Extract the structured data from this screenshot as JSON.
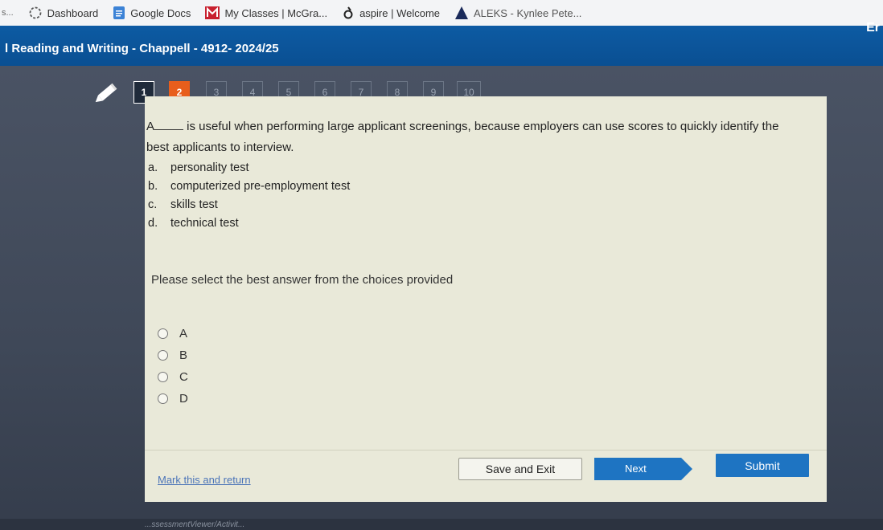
{
  "bookmarks": [
    {
      "label": "s...",
      "icon": "truncated-bookmark"
    },
    {
      "label": "Dashboard",
      "icon": "dashboard-icon"
    },
    {
      "label": "Google Docs",
      "icon": "google-docs-icon"
    },
    {
      "label": "My Classes | McGra...",
      "icon": "mcgraw-hill-icon"
    },
    {
      "label": "aspire | Welcome",
      "icon": "aspire-icon"
    },
    {
      "label": "ALEKS - Kynlee Pete...",
      "icon": "aleks-icon"
    }
  ],
  "header": {
    "course_title": "l Reading and Writing - Chappell - 4912- 2024/25",
    "right_label": "Er"
  },
  "nav": {
    "question_numbers": [
      {
        "label": "1",
        "state": "current"
      },
      {
        "label": "2",
        "state": "answered"
      },
      {
        "label": "3",
        "state": "unanswered"
      },
      {
        "label": "4",
        "state": "unanswered"
      },
      {
        "label": "5",
        "state": "unanswered"
      },
      {
        "label": "6",
        "state": "unanswered"
      },
      {
        "label": "7",
        "state": "unanswered"
      },
      {
        "label": "8",
        "state": "unanswered"
      },
      {
        "label": "9",
        "state": "unanswered"
      },
      {
        "label": "10",
        "state": "unanswered"
      }
    ]
  },
  "question": {
    "prefix": "A",
    "text_after_blank": " is useful when performing large applicant screenings, because employers can use scores to quickly identify the",
    "text_line2": "best applicants to interview.",
    "choices": [
      {
        "letter": "a.",
        "text": "personality test"
      },
      {
        "letter": "b.",
        "text": "computerized pre-employment test"
      },
      {
        "letter": "c.",
        "text": "skills test"
      },
      {
        "letter": "d.",
        "text": "technical test"
      }
    ]
  },
  "prompt": "Please select the best answer from the choices provided",
  "radio_options": [
    "A",
    "B",
    "C",
    "D"
  ],
  "footer": {
    "mark_link": "Mark this and return",
    "save_button": "Save and Exit",
    "next_button": "Next",
    "submit_button": "Submit"
  },
  "status_text": "...ssessmentViewer/Activit...",
  "colors": {
    "header_blue": "#0a4f92",
    "answered_orange": "#e85e1c",
    "submit_blue": "#1e74c2",
    "panel_bg": "#e9e9d9"
  }
}
